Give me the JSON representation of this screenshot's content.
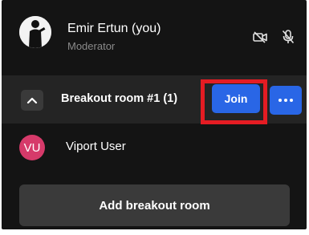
{
  "participant": {
    "name": "Emir Ertun (you)",
    "role": "Moderator",
    "icons": [
      "camera-off-icon",
      "mic-off-icon"
    ]
  },
  "breakout_room": {
    "title": "Breakout room #1 (1)",
    "join_label": "Join",
    "expanded": true,
    "collapse_icon": "chevron-up-icon",
    "more_icon": "more-dots-icon",
    "members": [
      {
        "initials": "VU",
        "name": "Viport User"
      }
    ]
  },
  "actions": {
    "add_room_label": "Add breakout room"
  },
  "colors": {
    "background": "#141414",
    "room_header": "#242424",
    "accent_blue": "#2966e6",
    "highlight_red": "#e51c23",
    "member_avatar": "#d63a6a",
    "muted_text": "#8a8a8a"
  }
}
